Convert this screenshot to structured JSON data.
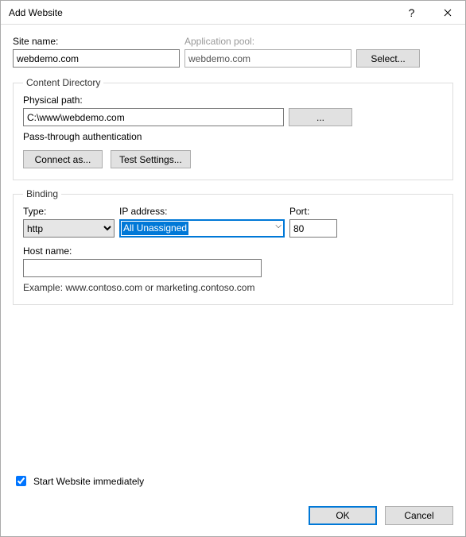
{
  "title": "Add Website",
  "labels": {
    "site_name": "Site name:",
    "app_pool": "Application pool:",
    "select_btn": "Select...",
    "physical_path": "Physical path:",
    "browse": "...",
    "pass_through": "Pass-through authentication",
    "connect_as": "Connect as...",
    "test_settings": "Test Settings...",
    "type": "Type:",
    "ip": "IP address:",
    "port": "Port:",
    "host_name": "Host name:",
    "example": "Example: www.contoso.com or marketing.contoso.com",
    "start_immediately": "Start Website immediately",
    "ok": "OK",
    "cancel": "Cancel",
    "content_directory": "Content Directory",
    "binding": "Binding"
  },
  "values": {
    "site_name": "webdemo.com",
    "app_pool": "webdemo.com",
    "physical_path": "C:\\www\\webdemo.com",
    "type": "http",
    "ip": "All Unassigned",
    "port": "80",
    "host_name": "",
    "start_immediately": true
  }
}
